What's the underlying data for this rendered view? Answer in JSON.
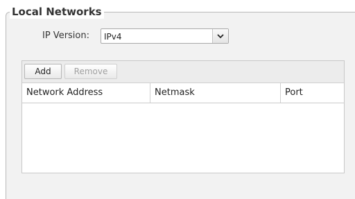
{
  "section": {
    "title": "Local Networks"
  },
  "ip_version": {
    "label": "IP Version:",
    "selected": "IPv4"
  },
  "toolbar": {
    "add_label": "Add",
    "remove_label": "Remove"
  },
  "table": {
    "columns": [
      "Network Address",
      "Netmask",
      "Port"
    ],
    "rows": []
  },
  "icons": {
    "dropdown": "chevron-down-icon"
  }
}
